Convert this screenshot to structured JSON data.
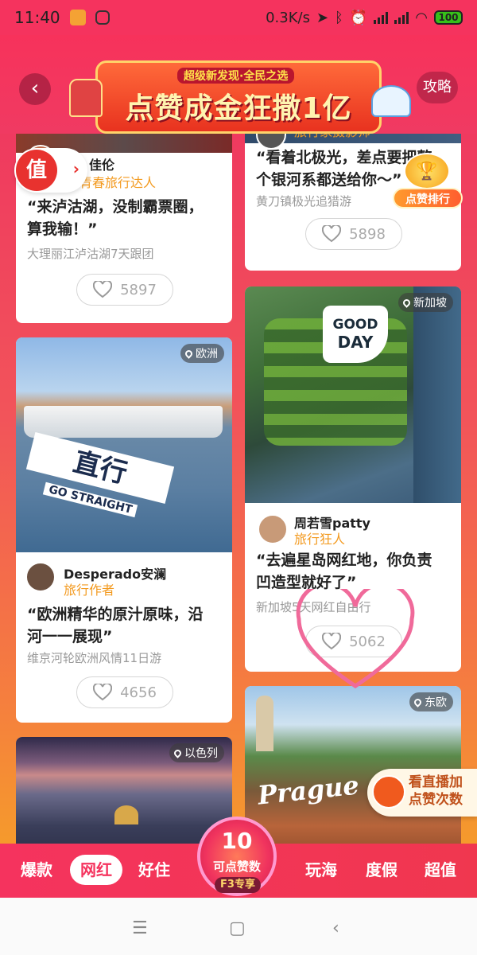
{
  "status_bar": {
    "time": "11:40",
    "net_speed": "0.3K/s",
    "battery": "100"
  },
  "header": {
    "back_icon": "chevron-left-icon",
    "strategy_label": "攻略",
    "banner_subtitle": "超级新发现·全民之选",
    "banner_title": "点赞成金狂撒1亿"
  },
  "floating": {
    "value_badge": "值",
    "rank_label": "点赞排行",
    "live_line1": "看直播加",
    "live_line2": "点赞次数"
  },
  "cards": [
    {
      "id": "lugu",
      "user_name": "佳伦",
      "user_role": "青春旅行达人",
      "quote_line1": "“来泸沽湖，没制霸票圈，",
      "quote_line2": "算我输！”",
      "trip": "大理丽江泸沽湖7天跟团",
      "likes": "5897"
    },
    {
      "id": "aurora",
      "user_role": "旅行家摄影师",
      "quote_line1": "“看着北极光，差点要把整",
      "quote_line2": "个银河系都送给你～”",
      "trip": "黄刀镇极光追猎游",
      "likes": "5898"
    },
    {
      "id": "europe",
      "location": "欧洲",
      "img_text_1": "直行",
      "img_text_2": "GO STRAIGHT",
      "user_name": "Desperado安澜",
      "user_role": "旅行作者",
      "quote_line1": "“欧洲精华的原汁原味，沿",
      "quote_line2": "河一一展现”",
      "trip": "维京河轮欧洲风情11日游",
      "likes": "4656"
    },
    {
      "id": "singapore",
      "location": "新加坡",
      "img_text_1": "GOOD",
      "img_text_2": "DAY",
      "user_name": "周若雪patty",
      "user_role": "旅行狂人",
      "quote_line1": "“去遍星岛网红地，你负责",
      "quote_line2": "凹造型就好了”",
      "trip": "新加坡5天网红自由行",
      "likes": "5062"
    },
    {
      "id": "israel",
      "location": "以色列"
    },
    {
      "id": "easteurope",
      "location": "东欧",
      "img_text_1": "Prague"
    }
  ],
  "bottom_nav": {
    "tabs": [
      "爆款",
      "网红",
      "好住",
      "玩海",
      "度假",
      "超值"
    ],
    "active_tab": "网红",
    "center_count": "10",
    "center_label": "可点赞数",
    "center_tag": "F3专享"
  },
  "colors": {
    "brand": "#f5335e",
    "accent_orange": "#f39a1f",
    "heart_pink": "#f06a9a"
  }
}
